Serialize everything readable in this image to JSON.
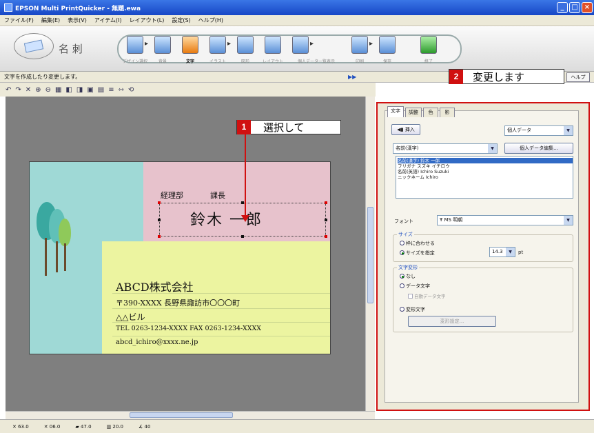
{
  "window": {
    "title": "EPSON Multi PrintQuicker - 無題.ewa"
  },
  "menu": [
    "ファイル(F)",
    "編集(E)",
    "表示(V)",
    "アイテム(I)",
    "レイアウト(L)",
    "設定(S)",
    "ヘルプ(H)"
  ],
  "toolbar": {
    "app_name": "名 刺",
    "steps": [
      {
        "label": "デザイン選択",
        "active": false
      },
      {
        "label": "背景",
        "active": false
      },
      {
        "label": "文字",
        "active": true
      },
      {
        "label": "イラスト",
        "active": false
      },
      {
        "label": "図形",
        "active": false
      },
      {
        "label": "レイアウト",
        "active": false
      },
      {
        "label": "個人データ一覧表示",
        "active": false
      },
      {
        "label": "印刷",
        "active": false
      },
      {
        "label": "保存",
        "active": false
      },
      {
        "label": "終了",
        "active": false
      }
    ]
  },
  "statusline": {
    "text": "文字を作成したり変更します。",
    "right_button": "ヘルプ"
  },
  "card": {
    "department": "経理部",
    "title": "課長",
    "name": "鈴木 一郎",
    "company": "ABCD株式会社",
    "address": "〒390-XXXX 長野県諏訪市〇〇〇町",
    "building": "△△ビル",
    "phone": "TEL 0263-1234-XXXX FAX 0263-1234-XXXX",
    "email": "abcd_ichiro@xxxx.ne.jp"
  },
  "callouts": {
    "c1": {
      "num": "1",
      "text": "選択して"
    },
    "c2": {
      "num": "2",
      "text": "変更します"
    }
  },
  "panel": {
    "tabs": [
      "文字",
      "調整",
      "色",
      "影"
    ],
    "insert_button": "挿入",
    "personal_data_dropdown": "個人データ",
    "field_dropdown": "名前(漢字)",
    "edit_data_button": "個人データ編集...",
    "list_items": [
      "名前(漢字) 鈴木 一郎",
      "フリガナ スズキ イチロウ",
      "名前(英語) Ichiro Suzuki",
      "ニックネーム Ichiro"
    ],
    "font_label": "フォント",
    "font_value": "MS 明朝",
    "size_group": "サイズ",
    "size_fit": "枠に合わせる",
    "size_specify": "サイズを指定",
    "size_value": "14.3",
    "size_unit": "pt",
    "insert_group": "文字変形",
    "opt_none": "なし",
    "opt_data": "データ文字",
    "opt_auto": "自動データ文字",
    "opt_deform": "変形文字",
    "deform_button": "変形設定..."
  },
  "bottombar": [
    "63.0",
    "06.0",
    "47.0",
    "20.0",
    "40"
  ]
}
